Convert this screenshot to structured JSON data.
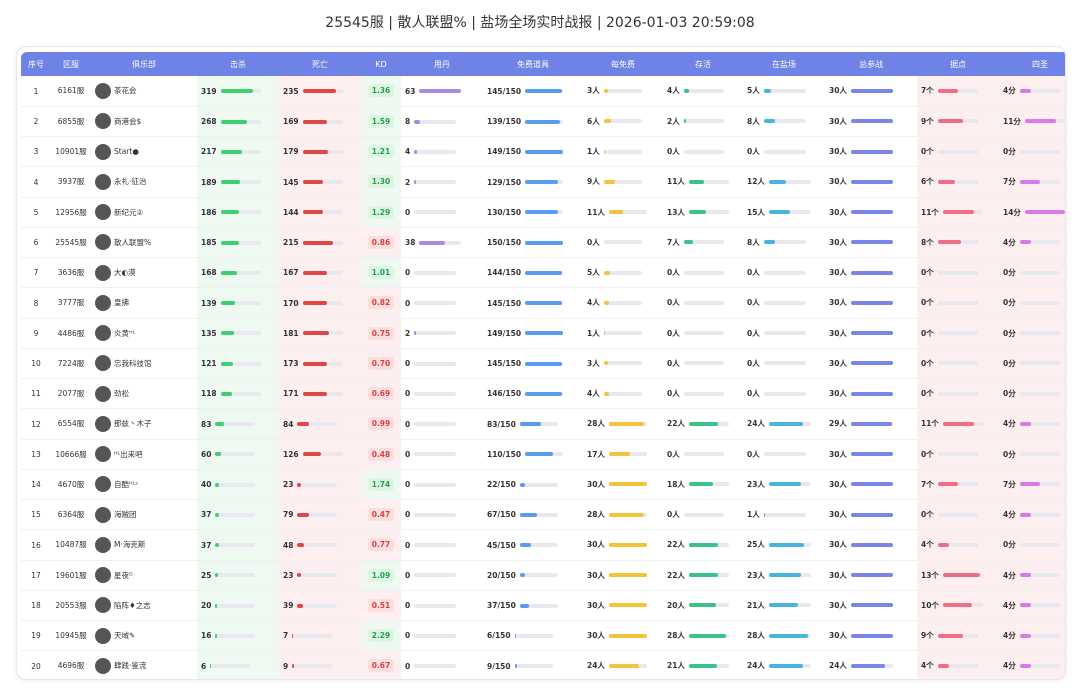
{
  "title": "25545服 | 散人联盟% | 盐场全场实时战报 | 2026-01-03 20:59:08",
  "headers": [
    "序号",
    "区服",
    "俱乐部",
    "击杀",
    "死亡",
    "KD",
    "用丹",
    "免费道具",
    "每免费",
    "存活",
    "在盐场",
    "总参战",
    "据点",
    "四圣"
  ],
  "colors": {
    "header": "#6f82e6",
    "kill": "#3ecf6e",
    "death": "#e04848",
    "dan": "#a78be6",
    "free": "#5a9bf0",
    "perfree": "#f2c43c",
    "alive": "#3ac28a",
    "inzone": "#46b6e0",
    "total": "#7888e8",
    "point": "#ee6f85",
    "four": "#d77bea",
    "track": "#e8e8ee"
  },
  "rows": [
    {
      "idx": "1",
      "server": "6161服",
      "club": "茶花会",
      "kill": 319,
      "death": 235,
      "kd": "1.36",
      "kd_good": true,
      "dan": 63,
      "free": "145/150",
      "free_v": 145,
      "per": "3人",
      "per_v": 3,
      "alive": "4人",
      "alive_v": 4,
      "inzone": "5人",
      "inzone_v": 5,
      "total": "30人",
      "total_v": 30,
      "point": "7个",
      "point_v": 7,
      "four": "4分",
      "four_v": 4
    },
    {
      "idx": "2",
      "server": "6855服",
      "club": "商港会$",
      "kill": 268,
      "death": 169,
      "kd": "1.59",
      "kd_good": true,
      "dan": 8,
      "free": "139/150",
      "free_v": 139,
      "per": "6人",
      "per_v": 6,
      "alive": "2人",
      "alive_v": 2,
      "inzone": "8人",
      "inzone_v": 8,
      "total": "30人",
      "total_v": 30,
      "point": "9个",
      "point_v": 9,
      "four": "11分",
      "four_v": 11
    },
    {
      "idx": "3",
      "server": "10901服",
      "club": "Start●",
      "kill": 217,
      "death": 179,
      "kd": "1.21",
      "kd_good": true,
      "dan": 4,
      "free": "149/150",
      "free_v": 149,
      "per": "1人",
      "per_v": 1,
      "alive": "0人",
      "alive_v": 0,
      "inzone": "0人",
      "inzone_v": 0,
      "total": "30人",
      "total_v": 30,
      "point": "0个",
      "point_v": 0,
      "four": "0分",
      "four_v": 0
    },
    {
      "idx": "4",
      "server": "3937服",
      "club": "永礼·征治",
      "kill": 189,
      "death": 145,
      "kd": "1.30",
      "kd_good": true,
      "dan": 2,
      "free": "129/150",
      "free_v": 129,
      "per": "9人",
      "per_v": 9,
      "alive": "11人",
      "alive_v": 11,
      "inzone": "12人",
      "inzone_v": 12,
      "total": "30人",
      "total_v": 30,
      "point": "6个",
      "point_v": 6,
      "four": "7分",
      "four_v": 7
    },
    {
      "idx": "5",
      "server": "12956服",
      "club": "新纪元②",
      "kill": 186,
      "death": 144,
      "kd": "1.29",
      "kd_good": true,
      "dan": 0,
      "free": "130/150",
      "free_v": 130,
      "per": "11人",
      "per_v": 11,
      "alive": "13人",
      "alive_v": 13,
      "inzone": "15人",
      "inzone_v": 15,
      "total": "30人",
      "total_v": 30,
      "point": "11个",
      "point_v": 11,
      "four": "14分",
      "four_v": 14
    },
    {
      "idx": "6",
      "server": "25545服",
      "club": "散人联盟%",
      "kill": 185,
      "death": 215,
      "kd": "0.86",
      "kd_good": false,
      "dan": 38,
      "free": "150/150",
      "free_v": 150,
      "per": "0人",
      "per_v": 0,
      "alive": "7人",
      "alive_v": 7,
      "inzone": "8人",
      "inzone_v": 8,
      "total": "30人",
      "total_v": 30,
      "point": "8个",
      "point_v": 8,
      "four": "4分",
      "four_v": 4
    },
    {
      "idx": "7",
      "server": "3636服",
      "club": "大◐漠",
      "kill": 168,
      "death": 167,
      "kd": "1.01",
      "kd_good": true,
      "dan": 0,
      "free": "144/150",
      "free_v": 144,
      "per": "5人",
      "per_v": 5,
      "alive": "0人",
      "alive_v": 0,
      "inzone": "0人",
      "inzone_v": 0,
      "total": "30人",
      "total_v": 30,
      "point": "0个",
      "point_v": 0,
      "four": "0分",
      "four_v": 0
    },
    {
      "idx": "8",
      "server": "3777服",
      "club": "皇拂",
      "kill": 139,
      "death": 170,
      "kd": "0.82",
      "kd_good": false,
      "dan": 0,
      "free": "145/150",
      "free_v": 145,
      "per": "4人",
      "per_v": 4,
      "alive": "0人",
      "alive_v": 0,
      "inzone": "0人",
      "inzone_v": 0,
      "total": "30人",
      "total_v": 30,
      "point": "0个",
      "point_v": 0,
      "four": "0分",
      "four_v": 0
    },
    {
      "idx": "9",
      "server": "4486服",
      "club": "炎黄ᴴᴸ",
      "kill": 135,
      "death": 181,
      "kd": "0.75",
      "kd_good": false,
      "dan": 2,
      "free": "149/150",
      "free_v": 149,
      "per": "1人",
      "per_v": 1,
      "alive": "0人",
      "alive_v": 0,
      "inzone": "0人",
      "inzone_v": 0,
      "total": "30人",
      "total_v": 30,
      "point": "0个",
      "point_v": 0,
      "four": "0分",
      "four_v": 0
    },
    {
      "idx": "10",
      "server": "7224服",
      "club": "忘我科技馆",
      "kill": 121,
      "death": 173,
      "kd": "0.70",
      "kd_good": false,
      "dan": 0,
      "free": "145/150",
      "free_v": 145,
      "per": "3人",
      "per_v": 3,
      "alive": "0人",
      "alive_v": 0,
      "inzone": "0人",
      "inzone_v": 0,
      "total": "30人",
      "total_v": 30,
      "point": "0个",
      "point_v": 0,
      "four": "0分",
      "four_v": 0
    },
    {
      "idx": "11",
      "server": "2077服",
      "club": "劲松",
      "kill": 118,
      "death": 171,
      "kd": "0.69",
      "kd_good": false,
      "dan": 0,
      "free": "146/150",
      "free_v": 146,
      "per": "4人",
      "per_v": 4,
      "alive": "0人",
      "alive_v": 0,
      "inzone": "0人",
      "inzone_v": 0,
      "total": "30人",
      "total_v": 30,
      "point": "0个",
      "point_v": 0,
      "four": "0分",
      "four_v": 0
    },
    {
      "idx": "12",
      "server": "6554服",
      "club": "那兹丶木子",
      "kill": 83,
      "death": 84,
      "kd": "0.99",
      "kd_good": false,
      "dan": 0,
      "free": "83/150",
      "free_v": 83,
      "per": "28人",
      "per_v": 28,
      "alive": "22人",
      "alive_v": 22,
      "inzone": "24人",
      "inzone_v": 24,
      "total": "29人",
      "total_v": 29,
      "point": "11个",
      "point_v": 11,
      "four": "4分",
      "four_v": 4
    },
    {
      "idx": "13",
      "server": "10666服",
      "club": "ᴴᴸ出来吧",
      "kill": 60,
      "death": 126,
      "kd": "0.48",
      "kd_good": false,
      "dan": 0,
      "free": "110/150",
      "free_v": 110,
      "per": "17人",
      "per_v": 17,
      "alive": "0人",
      "alive_v": 0,
      "inzone": "0人",
      "inzone_v": 0,
      "total": "30人",
      "total_v": 30,
      "point": "0个",
      "point_v": 0,
      "four": "0分",
      "four_v": 0
    },
    {
      "idx": "14",
      "server": "4670服",
      "club": "自酷ᴴᴸˢ",
      "kill": 40,
      "death": 23,
      "kd": "1.74",
      "kd_good": true,
      "dan": 0,
      "free": "22/150",
      "free_v": 22,
      "per": "30人",
      "per_v": 30,
      "alive": "18人",
      "alive_v": 18,
      "inzone": "23人",
      "inzone_v": 23,
      "total": "30人",
      "total_v": 30,
      "point": "7个",
      "point_v": 7,
      "four": "7分",
      "four_v": 7
    },
    {
      "idx": "15",
      "server": "6364服",
      "club": "海贼团",
      "kill": 37,
      "death": 79,
      "kd": "0.47",
      "kd_good": false,
      "dan": 0,
      "free": "67/150",
      "free_v": 67,
      "per": "28人",
      "per_v": 28,
      "alive": "0人",
      "alive_v": 0,
      "inzone": "1人",
      "inzone_v": 1,
      "total": "30人",
      "total_v": 30,
      "point": "0个",
      "point_v": 0,
      "four": "4分",
      "four_v": 4
    },
    {
      "idx": "16",
      "server": "10487服",
      "club": "M·海克斯",
      "kill": 37,
      "death": 48,
      "kd": "0.77",
      "kd_good": false,
      "dan": 0,
      "free": "45/150",
      "free_v": 45,
      "per": "30人",
      "per_v": 30,
      "alive": "22人",
      "alive_v": 22,
      "inzone": "25人",
      "inzone_v": 25,
      "total": "30人",
      "total_v": 30,
      "point": "4个",
      "point_v": 4,
      "four": "0分",
      "four_v": 0
    },
    {
      "idx": "17",
      "server": "19601服",
      "club": "星夜ᴰ",
      "kill": 25,
      "death": 23,
      "kd": "1.09",
      "kd_good": true,
      "dan": 0,
      "free": "20/150",
      "free_v": 20,
      "per": "30人",
      "per_v": 30,
      "alive": "22人",
      "alive_v": 22,
      "inzone": "23人",
      "inzone_v": 23,
      "total": "30人",
      "total_v": 30,
      "point": "13个",
      "point_v": 13,
      "four": "4分",
      "four_v": 4
    },
    {
      "idx": "18",
      "server": "20553服",
      "club": "陷阵♦之志",
      "kill": 20,
      "death": 39,
      "kd": "0.51",
      "kd_good": false,
      "dan": 0,
      "free": "37/150",
      "free_v": 37,
      "per": "30人",
      "per_v": 30,
      "alive": "20人",
      "alive_v": 20,
      "inzone": "21人",
      "inzone_v": 21,
      "total": "30人",
      "total_v": 30,
      "point": "10个",
      "point_v": 10,
      "four": "4分",
      "four_v": 4
    },
    {
      "idx": "19",
      "server": "10945服",
      "club": "天域✎",
      "kill": 16,
      "death": 7,
      "kd": "2.29",
      "kd_good": true,
      "dan": 0,
      "free": "6/150",
      "free_v": 6,
      "per": "30人",
      "per_v": 30,
      "alive": "28人",
      "alive_v": 28,
      "inzone": "28人",
      "inzone_v": 28,
      "total": "30人",
      "total_v": 30,
      "point": "9个",
      "point_v": 9,
      "four": "4分",
      "four_v": 4
    },
    {
      "idx": "20",
      "server": "4696服",
      "club": "肆践·鉴流",
      "kill": 6,
      "death": 9,
      "kd": "0.67",
      "kd_good": false,
      "dan": 0,
      "free": "9/150",
      "free_v": 9,
      "per": "24人",
      "per_v": 24,
      "alive": "21人",
      "alive_v": 21,
      "inzone": "24人",
      "inzone_v": 24,
      "total": "24人",
      "total_v": 24,
      "point": "4个",
      "point_v": 4,
      "four": "4分",
      "four_v": 4
    }
  ]
}
